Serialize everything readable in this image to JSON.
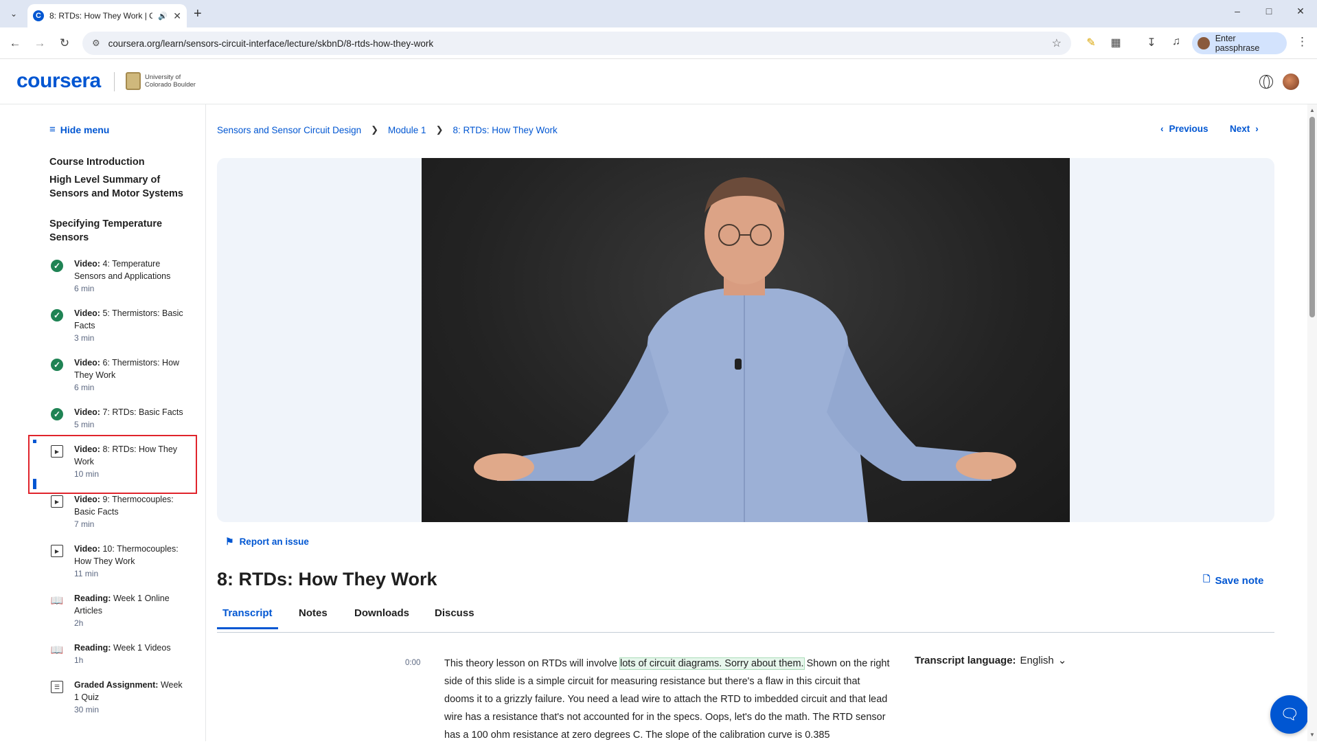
{
  "browser": {
    "tab_title": "8: RTDs: How They Work | C",
    "url": "coursera.org/learn/sensors-circuit-interface/lecture/skbnD/8-rtds-how-they-work",
    "profile_label": "Enter passphrase"
  },
  "header": {
    "logo": "coursera",
    "partner": "University of Colorado Boulder"
  },
  "sidebar": {
    "hide_menu": "Hide menu",
    "sections": [
      "Course Introduction",
      "High Level Summary of Sensors and Motor Systems",
      "Specifying Temperature Sensors"
    ],
    "items": [
      {
        "kind": "Video:",
        "title": " 4: Temperature Sensors and Applications",
        "duration": "6 min",
        "status": "completed"
      },
      {
        "kind": "Video:",
        "title": " 5: Thermistors: Basic Facts",
        "duration": "3 min",
        "status": "completed"
      },
      {
        "kind": "Video:",
        "title": " 6: Thermistors: How They Work",
        "duration": "6 min",
        "status": "completed"
      },
      {
        "kind": "Video:",
        "title": " 7: RTDs: Basic Facts",
        "duration": "5 min",
        "status": "completed"
      },
      {
        "kind": "Video:",
        "title": " 8: RTDs: How They Work",
        "duration": "10 min",
        "status": "current"
      },
      {
        "kind": "Video:",
        "title": " 9: Thermocouples: Basic Facts",
        "duration": "7 min",
        "status": "video"
      },
      {
        "kind": "Video:",
        "title": " 10: Thermocouples: How They Work",
        "duration": "11 min",
        "status": "video"
      },
      {
        "kind": "Reading:",
        "title": " Week 1 Online Articles",
        "duration": "2h",
        "status": "reading"
      },
      {
        "kind": "Reading:",
        "title": " Week 1 Videos",
        "duration": "1h",
        "status": "reading"
      },
      {
        "kind": "Graded Assignment:",
        "title": " Week 1 Quiz",
        "duration": "30 min",
        "status": "quiz"
      }
    ]
  },
  "main": {
    "breadcrumb": [
      "Sensors and Sensor Circuit Design",
      "Module 1",
      "8: RTDs: How They Work"
    ],
    "previous": "Previous",
    "next": "Next",
    "report_issue": "Report an issue",
    "title": "8: RTDs: How They Work",
    "save_note": "Save note",
    "tabs": [
      "Transcript",
      "Notes",
      "Downloads",
      "Discuss"
    ],
    "transcript_time": "0:00",
    "transcript_before": "This theory lesson on RTDs will involve ",
    "transcript_highlight": "lots of circuit diagrams. Sorry about them.",
    "transcript_after": " Shown on the right side of this slide is a simple circuit for measuring resistance but there's a flaw in this circuit that dooms it to a grizzly failure. You need a lead wire to attach the RTD to imbedded circuit and that lead wire has a resistance that's not accounted for in the specs. Oops, let's do the math. The RTD sensor has a 100 ohm resistance at zero degrees C. The slope of the calibration curve is 0.385",
    "transcript_language_label": "Transcript language:",
    "transcript_language": "English"
  },
  "colors": {
    "brand": "#0056d2",
    "completed": "#1f8354",
    "highlight_box": "#e0232b"
  }
}
